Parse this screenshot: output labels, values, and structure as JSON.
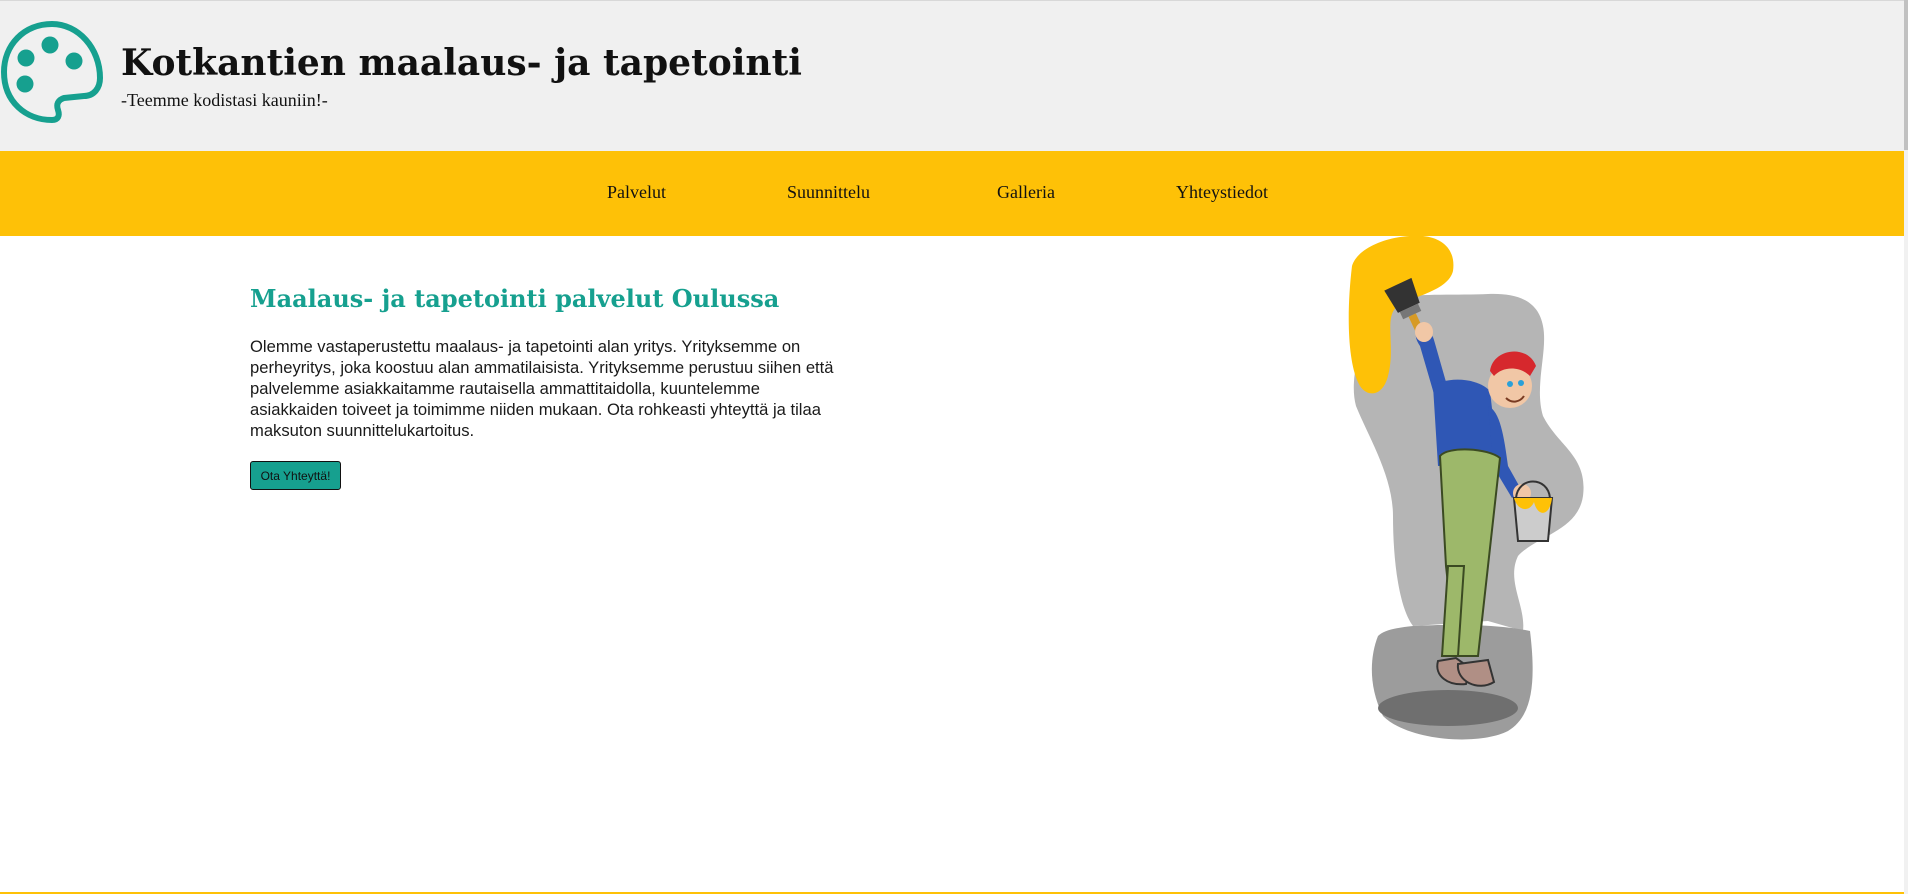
{
  "header": {
    "title": "Kotkantien maalaus- ja tapetointi",
    "tagline": "-Teemme kodistasi kauniin!-",
    "logo_icon": "palette-icon",
    "background_color": "#f0f0f0",
    "logo_color": "#16a08f"
  },
  "nav": {
    "background_color": "#fec107",
    "items": [
      {
        "label": "Palvelut"
      },
      {
        "label": "Suunnittelu"
      },
      {
        "label": "Galleria"
      },
      {
        "label": "Yhteystiedot"
      }
    ]
  },
  "main": {
    "heading": "Maalaus- ja tapetointi palvelut Oulussa",
    "heading_color": "#16a08f",
    "intro": "Olemme vastaperustettu maalaus- ja tapetointi alan yritys. Yrityksemme on perheyritys, joka koostuu alan ammatilaisista. Yrityksemme perustuu siihen että palvelemme asiakkaitamme rautaisella ammattitaidolla, kuuntelemme asiakkaiden toiveet ja toimimme niiden mukaan. Ota rohkeasti yhteyttä ja tilaa maksuton suunnittelukartoitus.",
    "cta_label": "Ota Yhteyttä!",
    "cta_color": "#16a08f",
    "illustration": "painter-illustration"
  }
}
